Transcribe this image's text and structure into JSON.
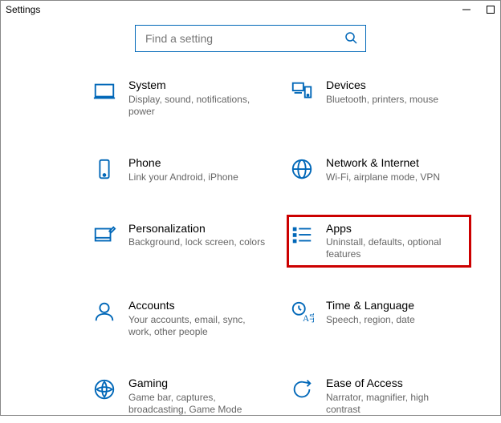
{
  "window": {
    "title": "Settings"
  },
  "search": {
    "placeholder": "Find a setting"
  },
  "tiles": [
    {
      "label": "System",
      "desc": "Display, sound, notifications, power"
    },
    {
      "label": "Devices",
      "desc": "Bluetooth, printers, mouse"
    },
    {
      "label": "Phone",
      "desc": "Link your Android, iPhone"
    },
    {
      "label": "Network & Internet",
      "desc": "Wi-Fi, airplane mode, VPN"
    },
    {
      "label": "Personalization",
      "desc": "Background, lock screen, colors"
    },
    {
      "label": "Apps",
      "desc": "Uninstall, defaults, optional features",
      "highlight": true
    },
    {
      "label": "Accounts",
      "desc": "Your accounts, email, sync, work, other people"
    },
    {
      "label": "Time & Language",
      "desc": "Speech, region, date"
    },
    {
      "label": "Gaming",
      "desc": "Game bar, captures, broadcasting, Game Mode"
    },
    {
      "label": "Ease of Access",
      "desc": "Narrator, magnifier, high contrast"
    }
  ]
}
